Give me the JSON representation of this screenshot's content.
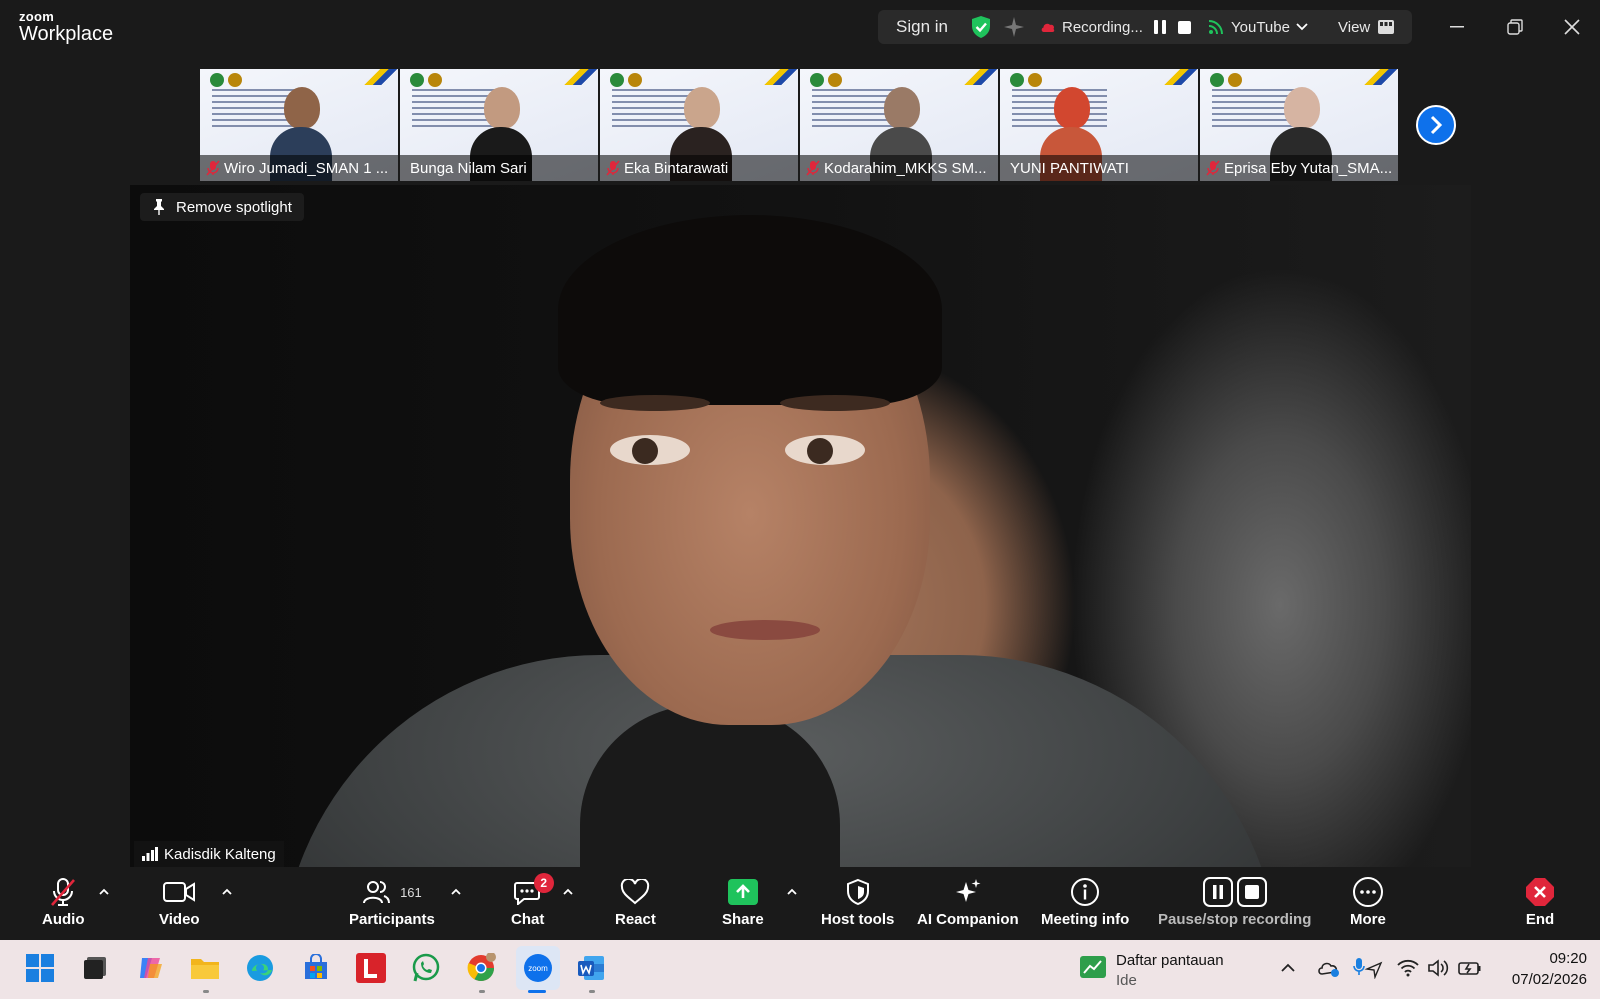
{
  "titlebar": {
    "brand_top": "zoom",
    "brand_bottom": "Workplace",
    "sign_in": "Sign in",
    "recording_label": "Recording...",
    "stream_label": "YouTube",
    "view_label": "View"
  },
  "strip": {
    "participants": [
      {
        "name": "Wiro Jumadi_SMAN 1 ..."
      },
      {
        "name": "Bunga Nilam Sari"
      },
      {
        "name": "Eka Bintarawati"
      },
      {
        "name": "Kodarahim_MKKS SM..."
      },
      {
        "name": "YUNI PANTIWATI"
      },
      {
        "name": "Eprisa Eby Yutan_SMA..."
      }
    ]
  },
  "stage": {
    "remove_spotlight": "Remove spotlight",
    "speaker_name": "Kadisdik Kalteng"
  },
  "toolbar": {
    "audio": "Audio",
    "video": "Video",
    "participants": "Participants",
    "participants_count": "161",
    "chat": "Chat",
    "chat_badge": "2",
    "react": "React",
    "share": "Share",
    "host_tools": "Host tools",
    "ai_companion": "AI Companion",
    "meeting_info": "Meeting info",
    "pause_stop_recording": "Pause/stop recording",
    "more": "More",
    "end": "End"
  },
  "taskbar": {
    "watchlist_title": "Daftar pantauan",
    "watchlist_sub": "Ide",
    "time": "09:20",
    "date": "07/02/2026"
  },
  "colors": {
    "share_green": "#1fc35c",
    "end_red": "#e0263b",
    "zoom_blue": "#0e71eb",
    "recording_red": "#e0263b"
  }
}
